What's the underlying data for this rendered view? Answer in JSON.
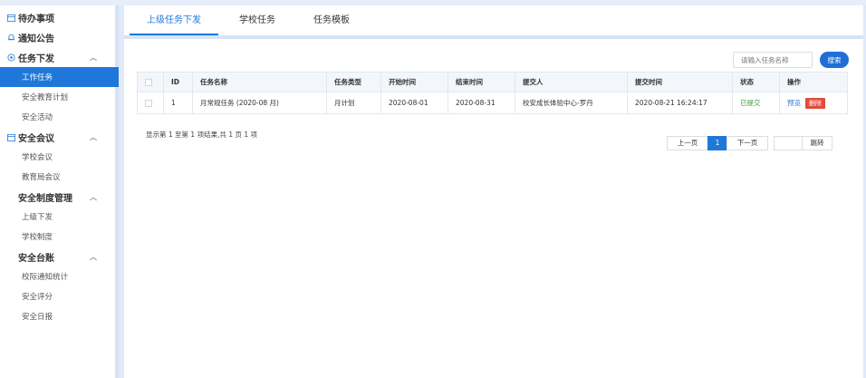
{
  "sidebar": {
    "items": [
      {
        "type": "group",
        "icon": "calendar-icon",
        "label": "待办事项",
        "chevron": false
      },
      {
        "type": "group",
        "icon": "bell-icon",
        "label": "通知公告",
        "chevron": false
      },
      {
        "type": "group",
        "icon": "target-icon",
        "label": "任务下发",
        "chevron": true
      },
      {
        "type": "sub",
        "label": "工作任务",
        "active": true
      },
      {
        "type": "sub",
        "label": "安全教育计划"
      },
      {
        "type": "sub",
        "label": "安全活动"
      },
      {
        "type": "group",
        "icon": "calendar-icon",
        "label": "安全会议",
        "chevron": true
      },
      {
        "type": "sub",
        "label": "学校会议"
      },
      {
        "type": "sub",
        "label": "教育局会议"
      },
      {
        "type": "group",
        "icon": "",
        "label": "安全制度管理",
        "chevron": true
      },
      {
        "type": "sub",
        "label": "上级下发"
      },
      {
        "type": "sub",
        "label": "学校制度"
      },
      {
        "type": "group",
        "icon": "",
        "label": "安全台账",
        "chevron": true
      },
      {
        "type": "sub",
        "label": "校际通知统计"
      },
      {
        "type": "sub",
        "label": "安全评分"
      },
      {
        "type": "sub",
        "label": "安全日报"
      }
    ],
    "chevron_glyph": "︿"
  },
  "tabs": [
    {
      "label": "上级任务下发",
      "active": true
    },
    {
      "label": "学校任务",
      "active": false
    },
    {
      "label": "任务模板",
      "active": false
    }
  ],
  "search": {
    "placeholder": "请输入任务名称",
    "button": "搜索"
  },
  "table": {
    "columns": [
      "",
      "ID",
      "任务名称",
      "任务类型",
      "开始时间",
      "结束时间",
      "提交人",
      "提交时间",
      "状态",
      "操作"
    ],
    "rows": [
      {
        "id": "1",
        "name": "月常规任务 (2020-08 月)",
        "type": "月计划",
        "start": "2020-08-01",
        "end": "2020-08-31",
        "submitter": "校安成长体验中心-罗丹",
        "submit_time": "2020-08-21 16:24:17",
        "status": "已提交",
        "preview": "预览",
        "delete": "删除"
      }
    ]
  },
  "summary": "显示第 1 至第 1 项结果,共 1 页 1 项",
  "pager": {
    "prev": "上一页",
    "current": "1",
    "next": "下一页",
    "jump": "跳转"
  },
  "colors": {
    "accent": "#1f78d9",
    "danger": "#e14b3b",
    "success": "#3aa23a"
  }
}
